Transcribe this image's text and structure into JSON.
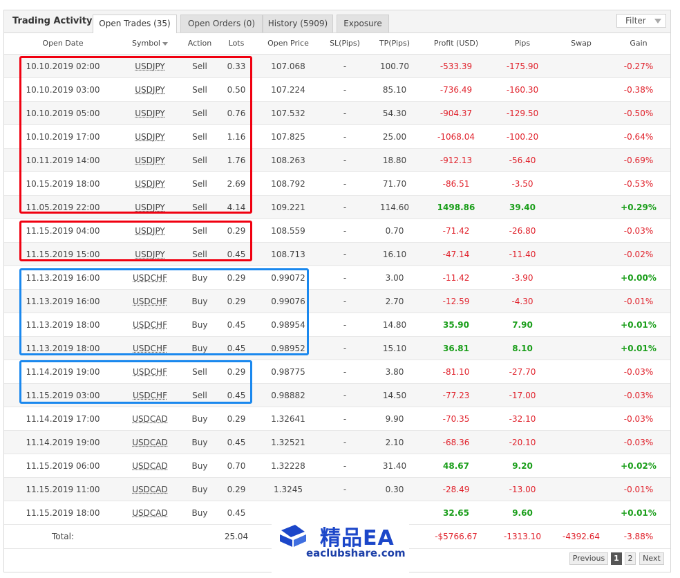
{
  "header": {
    "title": "Trading Activity",
    "tabs": [
      {
        "label": "Open Trades (35)",
        "active": true
      },
      {
        "label": "Open Orders (0)",
        "active": false
      },
      {
        "label": "History (5909)",
        "active": false
      },
      {
        "label": "Exposure",
        "active": false
      }
    ],
    "filter_label": "Filter"
  },
  "table": {
    "columns": [
      "Open Date",
      "Symbol",
      "Action",
      "Lots",
      "Open Price",
      "SL(Pips)",
      "TP(Pips)",
      "Profit (USD)",
      "Pips",
      "Swap",
      "Gain"
    ],
    "rows": [
      {
        "date": "10.10.2019 02:00",
        "symbol": "USDJPY",
        "action": "Sell",
        "lots": "0.33",
        "price": "107.068",
        "sl": "-",
        "tp": "100.70",
        "profit": "-533.39",
        "pips": "-175.90",
        "swap": "",
        "gain": "-0.27%"
      },
      {
        "date": "10.10.2019 03:00",
        "symbol": "USDJPY",
        "action": "Sell",
        "lots": "0.50",
        "price": "107.224",
        "sl": "-",
        "tp": "85.10",
        "profit": "-736.49",
        "pips": "-160.30",
        "swap": "",
        "gain": "-0.38%"
      },
      {
        "date": "10.10.2019 05:00",
        "symbol": "USDJPY",
        "action": "Sell",
        "lots": "0.76",
        "price": "107.532",
        "sl": "-",
        "tp": "54.30",
        "profit": "-904.37",
        "pips": "-129.50",
        "swap": "",
        "gain": "-0.50%"
      },
      {
        "date": "10.10.2019 17:00",
        "symbol": "USDJPY",
        "action": "Sell",
        "lots": "1.16",
        "price": "107.825",
        "sl": "-",
        "tp": "25.00",
        "profit": "-1068.04",
        "pips": "-100.20",
        "swap": "",
        "gain": "-0.64%"
      },
      {
        "date": "10.11.2019 14:00",
        "symbol": "USDJPY",
        "action": "Sell",
        "lots": "1.76",
        "price": "108.263",
        "sl": "-",
        "tp": "18.80",
        "profit": "-912.13",
        "pips": "-56.40",
        "swap": "",
        "gain": "-0.69%"
      },
      {
        "date": "10.15.2019 18:00",
        "symbol": "USDJPY",
        "action": "Sell",
        "lots": "2.69",
        "price": "108.792",
        "sl": "-",
        "tp": "71.70",
        "profit": "-86.51",
        "pips": "-3.50",
        "swap": "",
        "gain": "-0.53%"
      },
      {
        "date": "11.05.2019 22:00",
        "symbol": "USDJPY",
        "action": "Sell",
        "lots": "4.14",
        "price": "109.221",
        "sl": "-",
        "tp": "114.60",
        "profit": "1498.86",
        "pips": "39.40",
        "swap": "",
        "gain": "+0.29%"
      },
      {
        "date": "11.15.2019 04:00",
        "symbol": "USDJPY",
        "action": "Sell",
        "lots": "0.29",
        "price": "108.559",
        "sl": "-",
        "tp": "0.70",
        "profit": "-71.42",
        "pips": "-26.80",
        "swap": "",
        "gain": "-0.03%"
      },
      {
        "date": "11.15.2019 15:00",
        "symbol": "USDJPY",
        "action": "Sell",
        "lots": "0.45",
        "price": "108.713",
        "sl": "-",
        "tp": "16.10",
        "profit": "-47.14",
        "pips": "-11.40",
        "swap": "",
        "gain": "-0.02%"
      },
      {
        "date": "11.13.2019 16:00",
        "symbol": "USDCHF",
        "action": "Buy",
        "lots": "0.29",
        "price": "0.99072",
        "sl": "-",
        "tp": "3.00",
        "profit": "-11.42",
        "pips": "-3.90",
        "swap": "",
        "gain": "+0.00%"
      },
      {
        "date": "11.13.2019 16:00",
        "symbol": "USDCHF",
        "action": "Buy",
        "lots": "0.29",
        "price": "0.99076",
        "sl": "-",
        "tp": "2.70",
        "profit": "-12.59",
        "pips": "-4.30",
        "swap": "",
        "gain": "-0.01%"
      },
      {
        "date": "11.13.2019 18:00",
        "symbol": "USDCHF",
        "action": "Buy",
        "lots": "0.45",
        "price": "0.98954",
        "sl": "-",
        "tp": "14.80",
        "profit": "35.90",
        "pips": "7.90",
        "swap": "",
        "gain": "+0.01%"
      },
      {
        "date": "11.13.2019 18:00",
        "symbol": "USDCHF",
        "action": "Buy",
        "lots": "0.45",
        "price": "0.98952",
        "sl": "-",
        "tp": "15.10",
        "profit": "36.81",
        "pips": "8.10",
        "swap": "",
        "gain": "+0.01%"
      },
      {
        "date": "11.14.2019 19:00",
        "symbol": "USDCHF",
        "action": "Sell",
        "lots": "0.29",
        "price": "0.98775",
        "sl": "-",
        "tp": "3.80",
        "profit": "-81.10",
        "pips": "-27.70",
        "swap": "",
        "gain": "-0.03%"
      },
      {
        "date": "11.15.2019 03:00",
        "symbol": "USDCHF",
        "action": "Sell",
        "lots": "0.45",
        "price": "0.98882",
        "sl": "-",
        "tp": "14.50",
        "profit": "-77.23",
        "pips": "-17.00",
        "swap": "",
        "gain": "-0.03%"
      },
      {
        "date": "11.14.2019 17:00",
        "symbol": "USDCAD",
        "action": "Buy",
        "lots": "0.29",
        "price": "1.32641",
        "sl": "-",
        "tp": "9.90",
        "profit": "-70.35",
        "pips": "-32.10",
        "swap": "",
        "gain": "-0.03%"
      },
      {
        "date": "11.14.2019 19:00",
        "symbol": "USDCAD",
        "action": "Buy",
        "lots": "0.45",
        "price": "1.32521",
        "sl": "-",
        "tp": "2.10",
        "profit": "-68.36",
        "pips": "-20.10",
        "swap": "",
        "gain": "-0.03%"
      },
      {
        "date": "11.15.2019 06:00",
        "symbol": "USDCAD",
        "action": "Buy",
        "lots": "0.70",
        "price": "1.32228",
        "sl": "-",
        "tp": "31.40",
        "profit": "48.67",
        "pips": "9.20",
        "swap": "",
        "gain": "+0.02%"
      },
      {
        "date": "11.15.2019 11:00",
        "symbol": "USDCAD",
        "action": "Buy",
        "lots": "0.29",
        "price": "1.3245",
        "sl": "-",
        "tp": "0.30",
        "profit": "-28.49",
        "pips": "-13.00",
        "swap": "",
        "gain": "-0.01%"
      },
      {
        "date": "11.15.2019 18:00",
        "symbol": "USDCAD",
        "action": "Buy",
        "lots": "0.45",
        "price": "",
        "sl": "",
        "tp": "",
        "profit": "32.65",
        "pips": "9.60",
        "swap": "",
        "gain": "+0.01%"
      }
    ],
    "total": {
      "label": "Total:",
      "lots": "25.04",
      "profit": "-$5766.67",
      "pips": "-1313.10",
      "swap": "-4392.64",
      "gain": "-3.88%"
    }
  },
  "pagination": {
    "previous": "Previous",
    "pages": [
      "1",
      "2"
    ],
    "current": "1",
    "next": "Next"
  },
  "watermark": {
    "brand": "精品EA",
    "url": "eaclubshare.com"
  },
  "colors": {
    "negative": "#e0202a",
    "positive": "#1a9e1a",
    "highlight_red": "#f00010",
    "highlight_blue": "#1a88ee",
    "watermark_blue": "#1c47c9"
  }
}
